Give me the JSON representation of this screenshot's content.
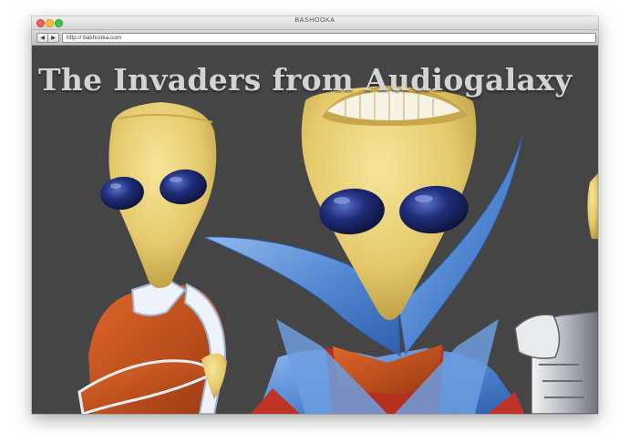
{
  "window": {
    "title": "BASHOOKA",
    "controls": [
      "close",
      "minimize",
      "maximize"
    ]
  },
  "toolbar": {
    "back_label": "◀",
    "forward_label": "▶",
    "url": "http:// bashooka.com"
  },
  "page": {
    "title": "The Invaders from Audiogalaxy",
    "background_color": "#454545"
  },
  "colors": {
    "alien_skin": "#e8d179",
    "eye": "#1c2a6b",
    "cape_blue": "#5b8fd3",
    "suit_orange": "#c9501c",
    "armor_silver": "#b9bcc2"
  }
}
